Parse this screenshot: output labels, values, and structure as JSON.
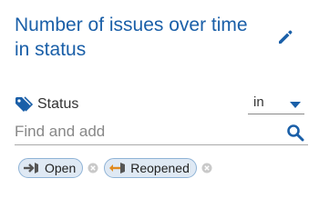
{
  "panel": {
    "title": "Number of issues over time in status"
  },
  "filter": {
    "label": "Status",
    "operator": "in",
    "search_placeholder": "Find and add",
    "selected": [
      {
        "label": "Open",
        "icon": "arrow-into-door-icon"
      },
      {
        "label": "Reopened",
        "icon": "reopen-arrow-icon"
      }
    ]
  },
  "colors": {
    "title": "#1a5fa8",
    "accent": "#1a5fa8",
    "chip_bg": "#dfe9f4",
    "chip_border": "#8fb3d6"
  }
}
